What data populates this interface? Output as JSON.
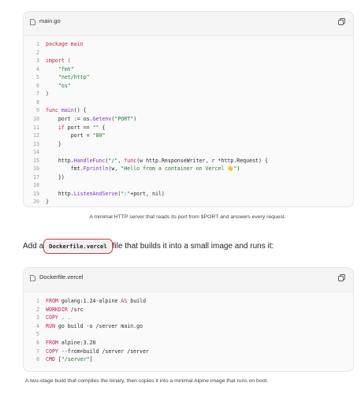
{
  "code_block_1": {
    "filename": "main.go",
    "lines": [
      {
        "n": "1",
        "parts": [
          {
            "t": "package main",
            "c": "kw"
          }
        ]
      },
      {
        "n": "2",
        "parts": [
          {
            "t": ""
          }
        ]
      },
      {
        "n": "3",
        "parts": [
          {
            "t": "import (",
            "c": "kw"
          }
        ]
      },
      {
        "n": "4",
        "parts": [
          {
            "t": "    \"fmt\"",
            "c": "str"
          }
        ]
      },
      {
        "n": "5",
        "parts": [
          {
            "t": "    \"net/http\"",
            "c": "str"
          }
        ]
      },
      {
        "n": "6",
        "parts": [
          {
            "t": "    \"os\"",
            "c": "str"
          }
        ]
      },
      {
        "n": "7",
        "parts": [
          {
            "t": ")"
          }
        ]
      },
      {
        "n": "8",
        "parts": [
          {
            "t": ""
          }
        ]
      },
      {
        "n": "9",
        "parts": [
          {
            "t": "func ",
            "c": "kw"
          },
          {
            "t": "main",
            "c": "fn"
          },
          {
            "t": "() {"
          }
        ]
      },
      {
        "n": "10",
        "parts": [
          {
            "t": "    port := os."
          },
          {
            "t": "Getenv",
            "c": "fn"
          },
          {
            "t": "(",
            "c": ""
          },
          {
            "t": "\"PORT\"",
            "c": "str"
          },
          {
            "t": ")"
          }
        ]
      },
      {
        "n": "11",
        "parts": [
          {
            "t": "    if ",
            "c": "kw"
          },
          {
            "t": "port == "
          },
          {
            "t": "\"\"",
            "c": "str"
          },
          {
            "t": " {"
          }
        ]
      },
      {
        "n": "12",
        "parts": [
          {
            "t": "        port = "
          },
          {
            "t": "\"80\"",
            "c": "str"
          }
        ]
      },
      {
        "n": "13",
        "parts": [
          {
            "t": "    }"
          }
        ]
      },
      {
        "n": "14",
        "parts": [
          {
            "t": ""
          }
        ]
      },
      {
        "n": "15",
        "parts": [
          {
            "t": "    http."
          },
          {
            "t": "HandleFunc",
            "c": "fn"
          },
          {
            "t": "("
          },
          {
            "t": "\"/\"",
            "c": "str"
          },
          {
            "t": ", "
          },
          {
            "t": "func",
            "c": "kw"
          },
          {
            "t": "(w http.ResponseWriter, r *http.Request) {"
          }
        ]
      },
      {
        "n": "16",
        "parts": [
          {
            "t": "        fmt."
          },
          {
            "t": "Fprintln",
            "c": "fn"
          },
          {
            "t": "(w, "
          },
          {
            "t": "\"Hello from a container on Vercel 👋\"",
            "c": "str"
          },
          {
            "t": ")"
          }
        ]
      },
      {
        "n": "17",
        "parts": [
          {
            "t": "    })"
          }
        ]
      },
      {
        "n": "18",
        "parts": [
          {
            "t": ""
          }
        ]
      },
      {
        "n": "19",
        "parts": [
          {
            "t": "    http."
          },
          {
            "t": "ListenAndServe",
            "c": "fn"
          },
          {
            "t": "("
          },
          {
            "t": "\":\"",
            "c": "str"
          },
          {
            "t": "+port, nil)"
          }
        ]
      },
      {
        "n": "20",
        "parts": [
          {
            "t": "}"
          }
        ]
      }
    ]
  },
  "caption_1": "A minimal HTTP server that reads its port from $PORT and answers every request.",
  "prose": {
    "before": "Add a",
    "code": "Dockerfile.vercel",
    "after": "file that builds it into a small image and runs it:"
  },
  "code_block_2": {
    "filename": "Dockerfile.vercel",
    "lines": [
      {
        "n": "1",
        "parts": [
          {
            "t": "FROM ",
            "c": "kw"
          },
          {
            "t": "golang:1.24-alpine "
          },
          {
            "t": "AS ",
            "c": "kw"
          },
          {
            "t": "build"
          }
        ]
      },
      {
        "n": "2",
        "parts": [
          {
            "t": "WORKDIR ",
            "c": "kw"
          },
          {
            "t": "/src"
          }
        ]
      },
      {
        "n": "3",
        "parts": [
          {
            "t": "COPY ",
            "c": "kw"
          },
          {
            "t": ". ."
          }
        ]
      },
      {
        "n": "4",
        "parts": [
          {
            "t": "RUN ",
            "c": "kw"
          },
          {
            "t": "go build -o /server main.go"
          }
        ]
      },
      {
        "n": "5",
        "parts": [
          {
            "t": ""
          }
        ]
      },
      {
        "n": "6",
        "parts": [
          {
            "t": "FROM ",
            "c": "kw"
          },
          {
            "t": "alpine:3.20"
          }
        ]
      },
      {
        "n": "7",
        "parts": [
          {
            "t": "COPY ",
            "c": "kw"
          },
          {
            "t": "--from=build /server /server"
          }
        ]
      },
      {
        "n": "8",
        "parts": [
          {
            "t": "CMD ",
            "c": "kw"
          },
          {
            "t": "["
          },
          {
            "t": "\"/server\"",
            "c": "str"
          },
          {
            "t": "]"
          }
        ]
      }
    ]
  },
  "caption_2": "A two-stage build that compiles the binary, then copies it into a minimal Alpine image that runs on boot.",
  "icons": {
    "file": "file-icon",
    "copy": "copy-icon"
  },
  "colors": {
    "keyword": "#c4224a",
    "string": "#1a7a3a",
    "function": "#7a33c4",
    "highlight_outline": "#e03030"
  }
}
